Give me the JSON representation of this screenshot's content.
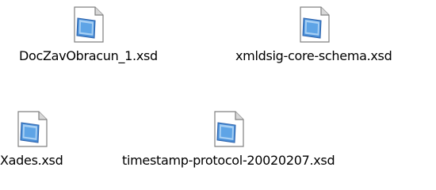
{
  "files": [
    {
      "name": "DocZavObracun_1.xsd",
      "icon": "xsd-document-icon"
    },
    {
      "name": "xmldsig-core-schema.xsd",
      "icon": "xsd-document-icon"
    },
    {
      "name": "Xades.xsd",
      "icon": "xsd-document-icon"
    },
    {
      "name": "timestamp-protocol-20020207.xsd",
      "icon": "xsd-document-icon"
    }
  ],
  "colors": {
    "page_fill": "#ffffff",
    "page_border": "#808080",
    "fold_fill": "#d8d8d8",
    "glyph_main": "#4a8fd8",
    "glyph_dark": "#2a5fa8",
    "glyph_light": "#a8d0f4"
  }
}
